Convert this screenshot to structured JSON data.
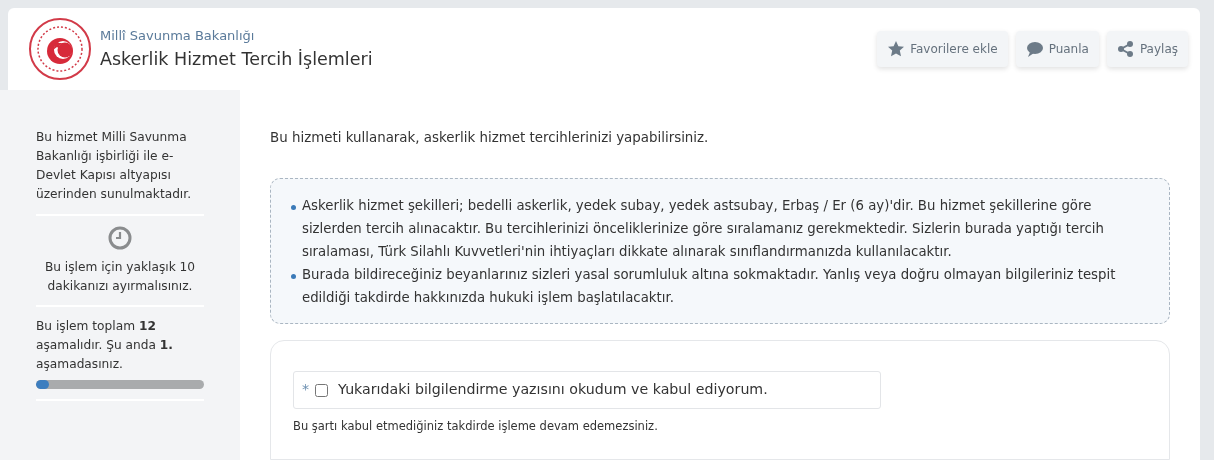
{
  "header": {
    "ministry": "Millî Savunma Bakanlığı",
    "title": "Askerlik Hizmet Tercih İşlemleri",
    "actions": [
      {
        "kind": "star",
        "label": "Favorilere ekle"
      },
      {
        "kind": "comment",
        "label": "Puanla"
      },
      {
        "kind": "share",
        "label": "Paylaş"
      }
    ]
  },
  "sidebar": {
    "provider_note": "Bu hizmet Milli Savunma Bakanlığı işbirliği ile e-Devlet Kapısı altyapısı üzerinden sunulmaktadır.",
    "duration_note": "Bu işlem için yaklaşık 10 dakikanızı ayırmalısınız.",
    "steps_note": "Bu işlem toplam **12** aşamalıdır. Şu anda **1.** aşamadasınız.",
    "progress": {
      "level": 0.08
    }
  },
  "main": {
    "intro": "Bu hizmeti kullanarak, askerlik hizmet tercihlerinizi yapabilirsiniz.",
    "info_items": [
      "Askerlik hizmet şekilleri; bedelli askerlik, yedek subay, yedek astsubay, Erbaş / Er (6 ay)'dir. Bu hizmet şekillerine göre sizlerden tercih alınacaktır. Bu tercihlerinizi önceliklerinize göre sıralamanız gerekmektedir. Sizlerin burada yaptığı tercih sıralaması, Türk Silahlı Kuvvetleri'nin ihtiyaçları dikkate alınarak sınıflandırmanızda kullanılacaktır.",
      "Burada bildireceğiniz beyanlarınız sizleri yasal sorumluluk altına sokmaktadır. Yanlış veya doğru olmayan bilgileriniz tespit edildiği takdirde hakkınızda hukuki işlem başlatılacaktır."
    ],
    "consent": {
      "required_mark": "*",
      "label": "Yukarıdaki bilgilendirme yazısını okudum ve kabul ediyorum.",
      "checked": false,
      "help": "Bu şartı kabul etmediğiniz takdirde işleme devam edemezsiniz."
    }
  }
}
